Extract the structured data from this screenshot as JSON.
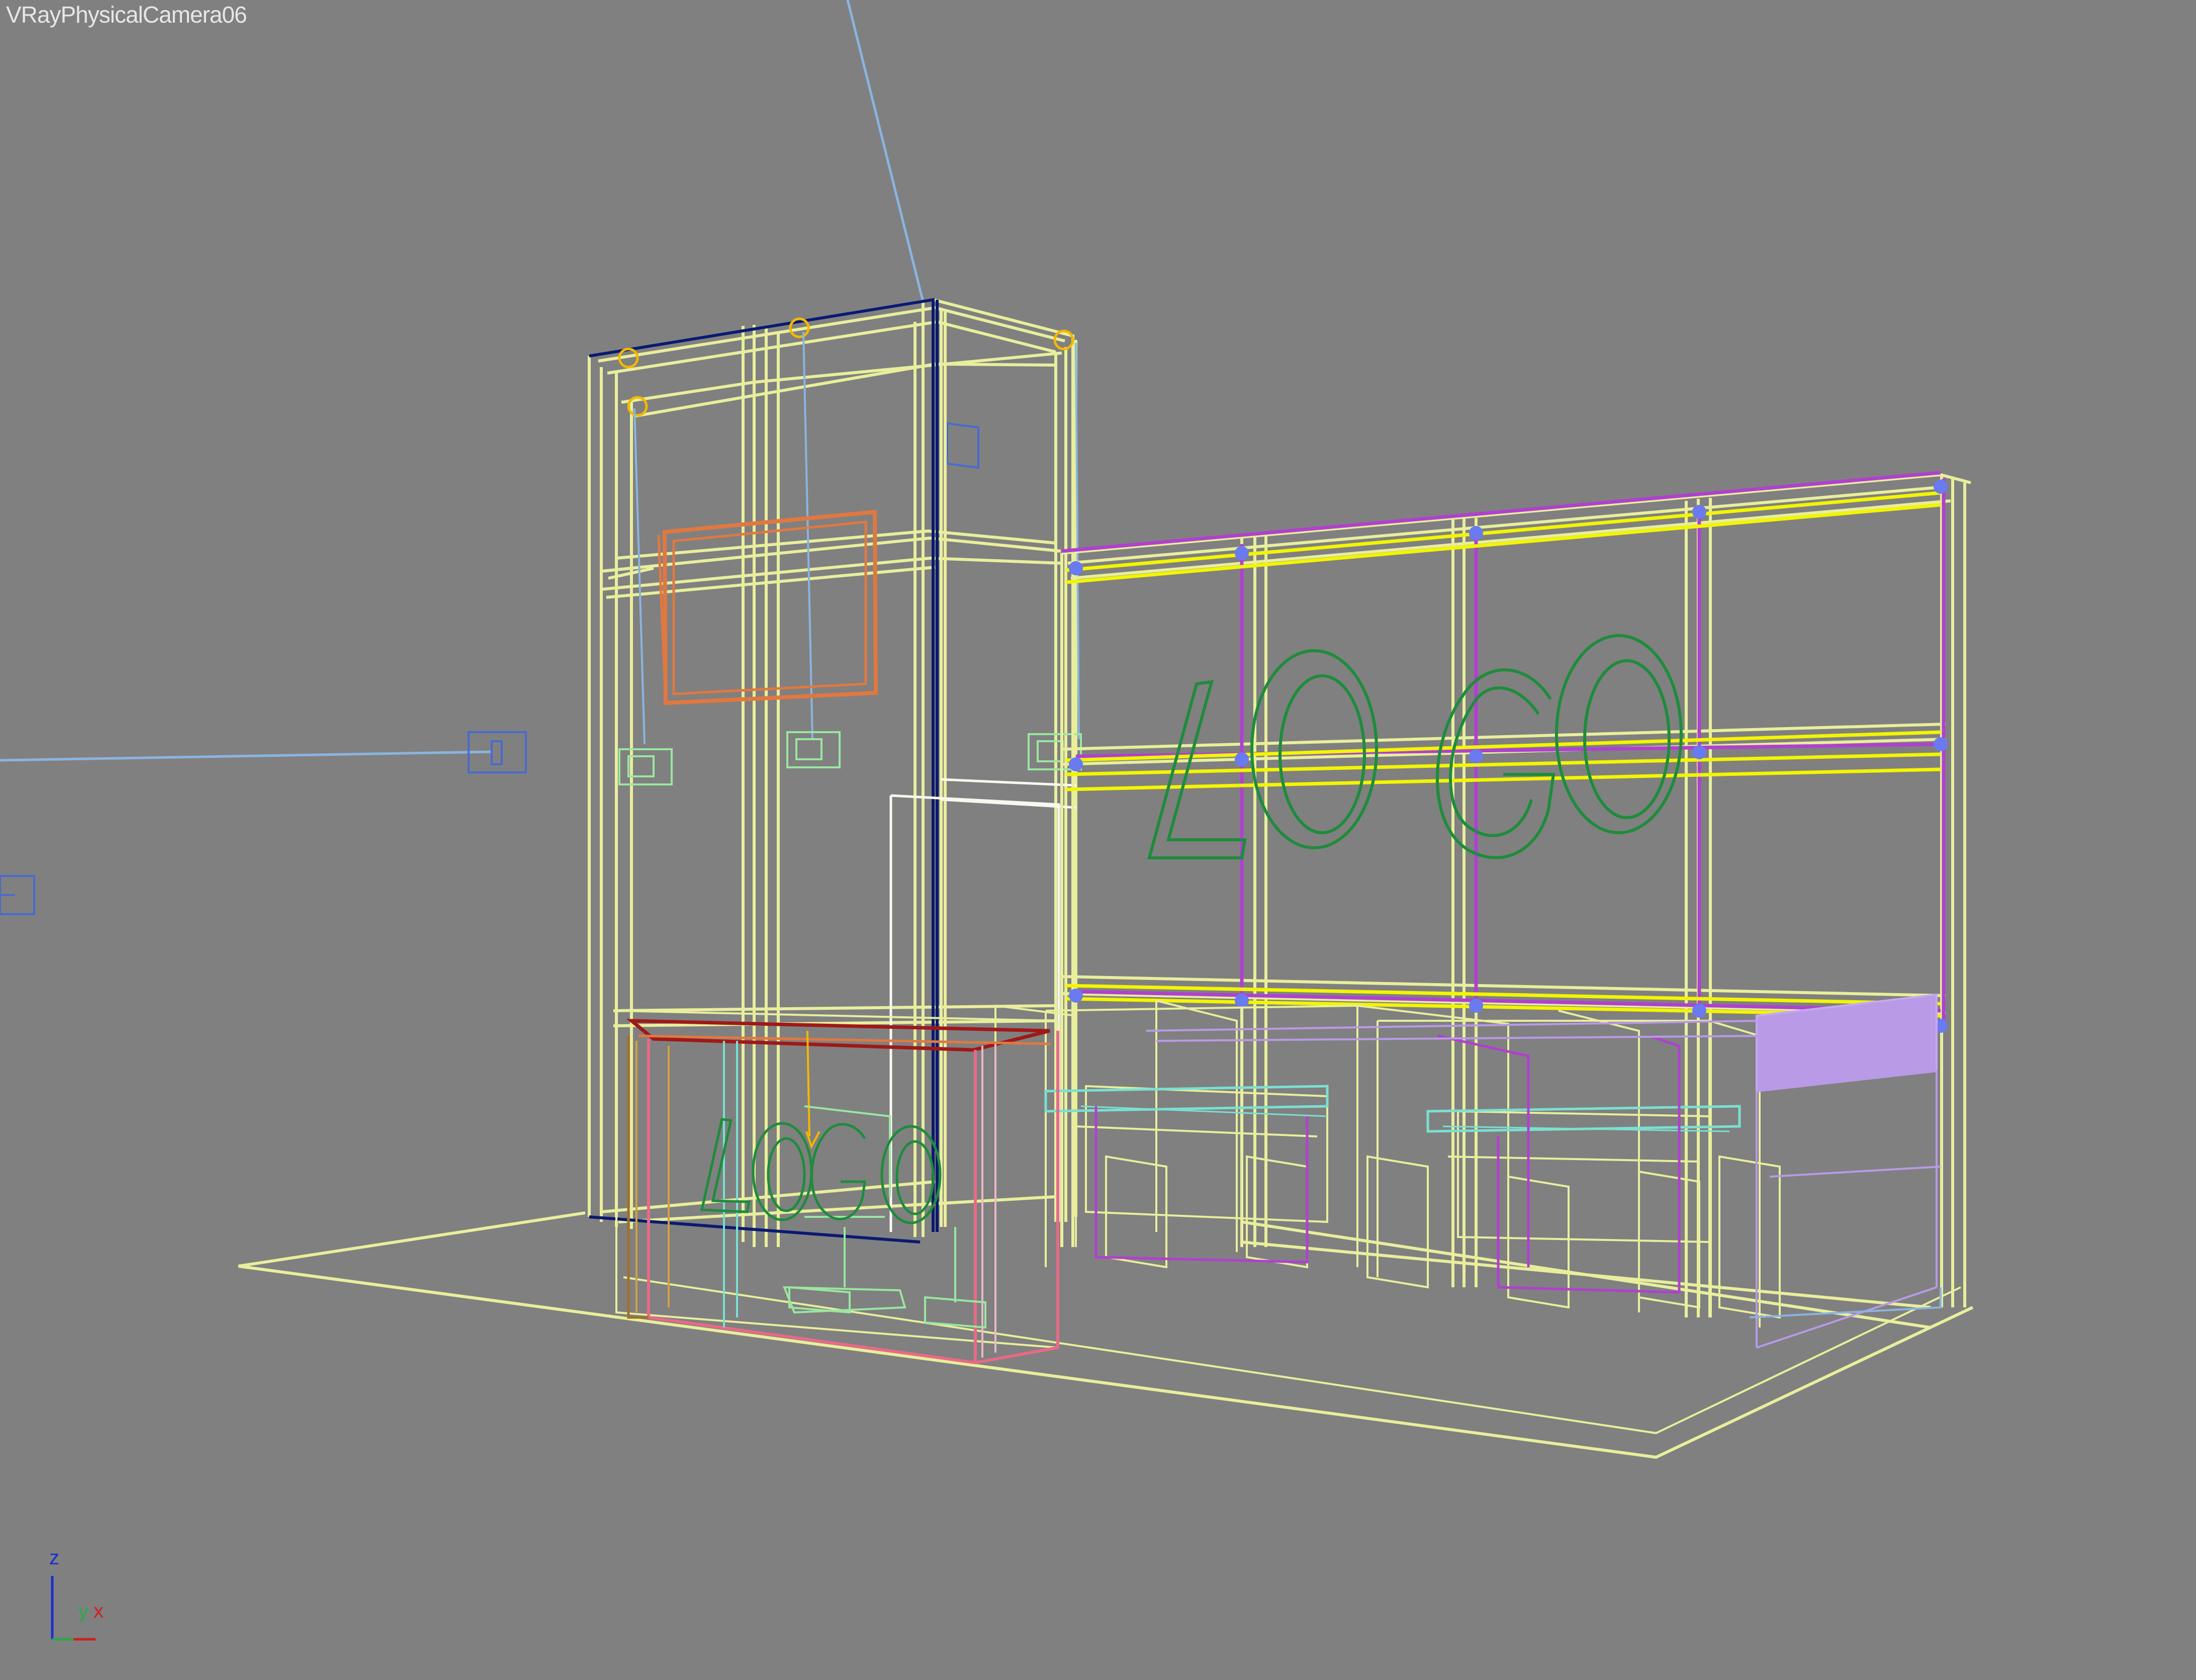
{
  "viewport": {
    "label": "VRayPhysicalCamera06",
    "background": "#808080"
  },
  "scene": {
    "logo_text": "LOGO",
    "colors": {
      "frame": "#e8ee9c",
      "frame_bright": "#f2f500",
      "logo": "#1e8c3c",
      "magenta": "#b040d0",
      "orange": "#e07840",
      "dark_blue": "#0a1a70",
      "light_blue": "#8ab4e0",
      "pink": "#e86a86",
      "lavender": "#b89ae6",
      "red": "#a01818"
    }
  },
  "axis_gizmo": {
    "z_label": "z",
    "y_label": "y",
    "x_label": "x",
    "z_color": "#1a2fd0",
    "y_color": "#2aa84a",
    "x_color": "#d02020"
  }
}
